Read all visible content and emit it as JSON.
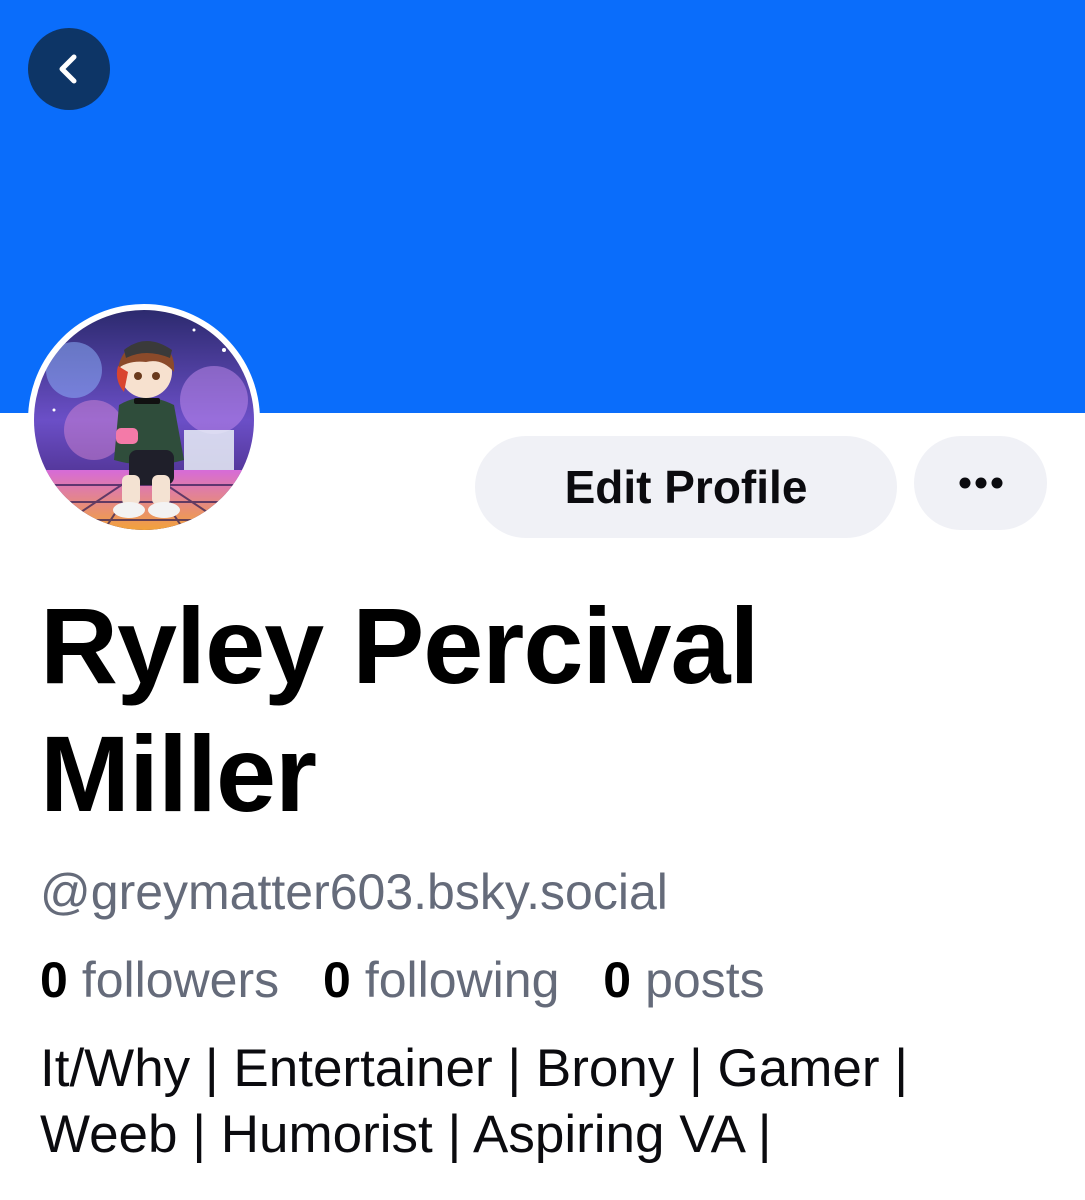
{
  "header": {
    "back_icon": "chevron-left-icon",
    "banner_color": "#0a6dfb"
  },
  "profile": {
    "display_name": "Ryley Percival Miller",
    "handle": "@greymatter603.bsky.social",
    "bio": "It/Why | Entertainer | Brony | Gamer | Weeb | Humorist | Aspiring VA |"
  },
  "actions": {
    "edit_label": "Edit Profile",
    "more_icon": "more-horizontal-icon"
  },
  "stats": {
    "followers_count": "0",
    "followers_label": "followers",
    "following_count": "0",
    "following_label": "following",
    "posts_count": "0",
    "posts_label": "posts"
  }
}
